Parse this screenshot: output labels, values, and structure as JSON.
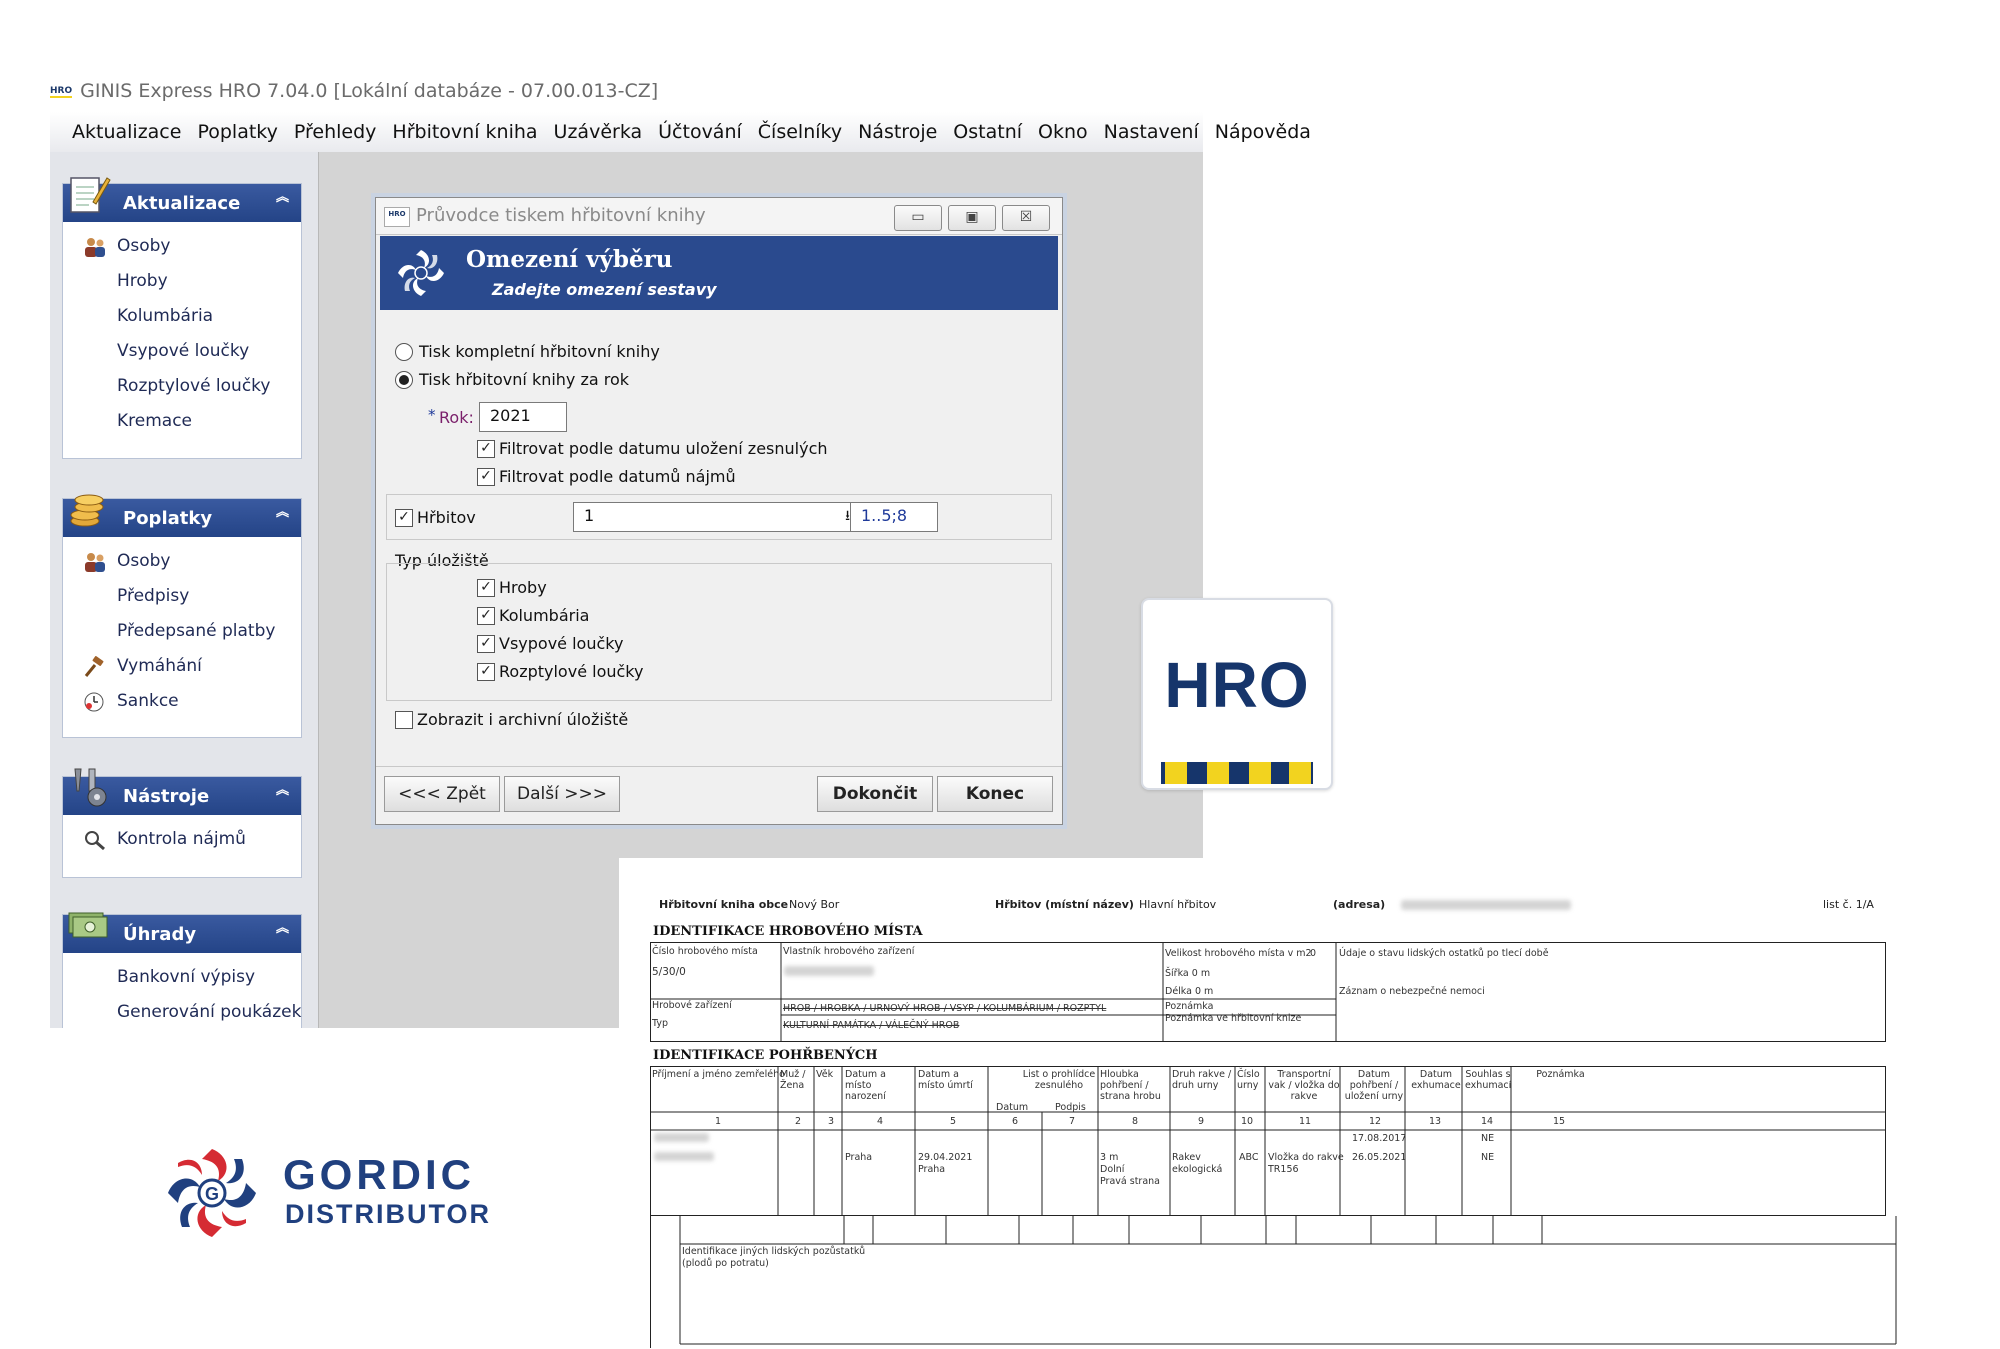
{
  "app": {
    "title": "GINIS Express HRO 7.04.0 [Lokální databáze - 07.00.013-CZ]",
    "logo_text": "HRO",
    "menu": [
      "Aktualizace",
      "Poplatky",
      "Přehledy",
      "Hřbitovní kniha",
      "Uzávěrka",
      "Účtování",
      "Číselníky",
      "Nástroje",
      "Ostatní",
      "Okno",
      "Nastavení",
      "Nápověda"
    ]
  },
  "sidebar": {
    "groups": [
      {
        "title": "Aktualizace",
        "items": [
          "Osoby",
          "Hroby",
          "Kolumbária",
          "Vsypové loučky",
          "Rozptylové loučky",
          "Kremace"
        ]
      },
      {
        "title": "Poplatky",
        "items": [
          "Osoby",
          "Předpisy",
          "Předepsané platby",
          "Vymáhání",
          "Sankce"
        ]
      },
      {
        "title": "Nástroje",
        "items": [
          "Kontrola nájmů"
        ]
      },
      {
        "title": "Úhrady",
        "items": [
          "Bankovní výpisy",
          "Generování poukázek"
        ]
      }
    ]
  },
  "dialog": {
    "title": "Průvodce tiskem hřbitovní knihy",
    "heading": "Omezení výběru",
    "subheading": "Zadejte omezení sestavy",
    "radio_full": "Tisk kompletní hřbitovní knihy",
    "radio_year": "Tisk hřbitovní knihy za rok",
    "year_label": "Rok:",
    "year_required_mark": "*",
    "year_value": "2021",
    "chk_filter_deceased": "Filtrovat podle datumu uložení zesnulých",
    "chk_filter_leases": "Filtrovat podle datumů nájmů",
    "cemetery_label": "Hřbitov",
    "cemetery_value": "1",
    "cemetery_range": "1..5;8",
    "storage_type_label": "Typ úložiště",
    "storage_types": [
      "Hroby",
      "Kolumbária",
      "Vsypové loučky",
      "Rozptylové loučky"
    ],
    "chk_archive": "Zobrazit i archivní úložiště",
    "btn_back": "<<< Zpět",
    "btn_next": "Další >>>",
    "btn_finish": "Dokončit",
    "btn_end": "Konec",
    "window_buttons": [
      "▭",
      "▣",
      "☒"
    ]
  },
  "hro_logo": {
    "text": "HRO",
    "brand_color": "#16356b",
    "accent_color": "#f2d31f"
  },
  "gordic_logo": {
    "line1": "GORDIC",
    "line2": "DISTRIBUTOR",
    "brand_color": "#20407f",
    "accent_color": "#d52b33"
  },
  "report": {
    "book_label": "Hřbitovní kniha obce",
    "book_value": "Nový Bor",
    "cemetery_label": "Hřbitov (místní název)",
    "cemetery_value": "Hlavní hřbitov",
    "address_label": "(adresa)",
    "sheet": "list č. 1/A",
    "section1": "IDENTIFIKACE HROBOVÉHO MÍSTA",
    "grave_no_label": "Číslo hrobového místa",
    "grave_no_value": "5/30/0",
    "owner_label": "Vlastník hrobového zařízení",
    "size_label": "Velikost hrobového místa v m2",
    "size_value": "0",
    "width_label": "Šířka 0 m",
    "length_label": "Délka 0 m",
    "remains_label": "Údaje o stavu lidských ostatků po tlecí době",
    "disease_label": "Záznam o nebezpečné nemoci",
    "equipment_label": "Hrobové zařízení",
    "type_label": "Typ",
    "types_line1": "HROB / HROBKA / URNOVÝ HROB / VSYP / KOLUMBÁRIUM / ROZPTYL",
    "types_line2": "KULTURNÍ PAMÁTKA / VÁLEČNÝ HROB",
    "note_label": "Poznámka",
    "note_book_label": "Poznámka ve hřbitovní knize",
    "section2": "IDENTIFIKACE POHŘBENÝCH",
    "columns": [
      "Příjmení a jméno zemřelého",
      "Muž / Žena",
      "Věk",
      "Datum a místo narození",
      "Datum a místo úmrtí",
      "List o prohlídce zesnulého",
      "Hloubka pohřbení / strana hrobu",
      "Druh rakve / druh urny",
      "Číslo urny",
      "Transportní vak / vložka do rakve",
      "Datum pohřbení / uložení urny",
      "Datum exhumace",
      "Souhlas s exhumací",
      "Poznámka"
    ],
    "list_sub": [
      "Datum",
      "Podpis"
    ],
    "column_numbers": [
      "1",
      "2",
      "3",
      "4",
      "5",
      "6",
      "7",
      "8",
      "9",
      "10",
      "11",
      "12",
      "13",
      "14",
      "15"
    ],
    "row1": {
      "birth_place": "Praha",
      "death": "29.04.2021",
      "death_place": "Praha",
      "depth": "3 m",
      "side1": "Dolní",
      "side2": "Pravá strana",
      "coffin1": "Rakev",
      "coffin2": "ekologická",
      "urn": "ABC",
      "insert1": "Vložka do rakve",
      "insert2": "TR156",
      "date1": "17.08.2017",
      "date2": "26.05.2021",
      "consent1": "NE",
      "consent2": "NE"
    },
    "other_remains": "Identifikace jiných lidských pozůstatků",
    "other_remains_sub": "(plodů po potratu)"
  }
}
